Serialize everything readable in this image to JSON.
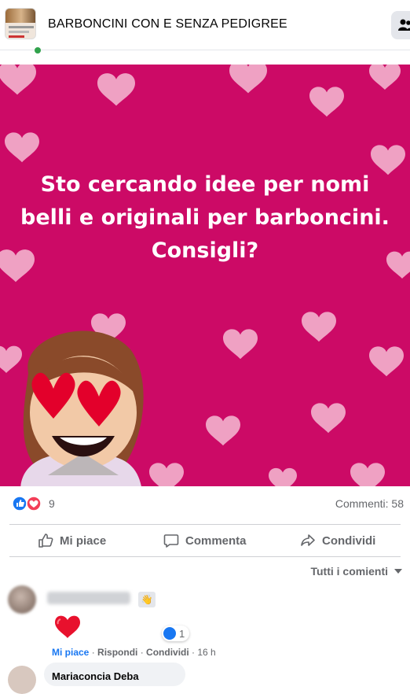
{
  "header": {
    "group_name": "BARBONCINI CON E SENZA PEDIGREE"
  },
  "post": {
    "text": "Sto cercando idee per nomi belli e originali per barboncini. Consigli?",
    "background_color": "#cc0a66"
  },
  "reactions": {
    "count": "9",
    "comments": "Commenti: 58"
  },
  "actions": {
    "like": "Mi piace",
    "comment": "Commenta",
    "share": "Condividi"
  },
  "comments_filter": "Tutti i comienti",
  "comment": {
    "reaction_count": "1",
    "like": "Mi piace",
    "reply": "Rispondi",
    "share": "Condividi",
    "time": "16 h",
    "sep": " · "
  },
  "next_comment": {
    "name": "Mariaconcia Deba"
  },
  "icons": [
    "group-icon",
    "like-icon",
    "comment-icon",
    "share-icon",
    "heart-icon",
    "wave-icon"
  ]
}
